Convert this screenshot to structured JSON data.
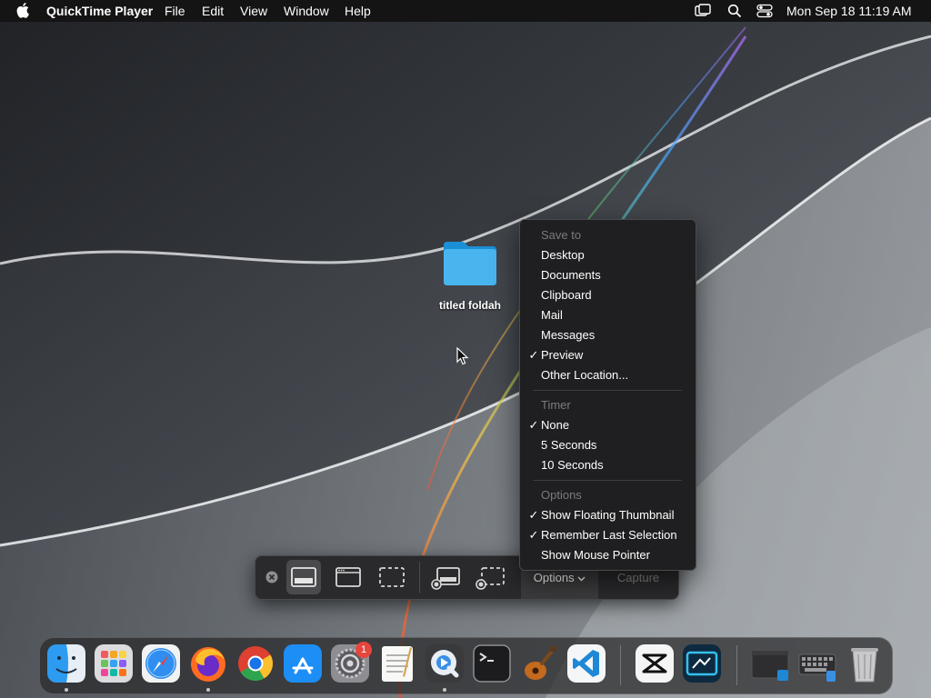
{
  "menubar": {
    "app_name": "QuickTime Player",
    "items": [
      "File",
      "Edit",
      "View",
      "Window",
      "Help"
    ],
    "clock": "Mon Sep 18  11:19 AM"
  },
  "desktop": {
    "folder_label": "titled foldah"
  },
  "toolbar": {
    "options_label": "Options",
    "capture_label": "Capture"
  },
  "options_menu": {
    "save_to_header": "Save to",
    "save_to": [
      {
        "label": "Desktop",
        "checked": false
      },
      {
        "label": "Documents",
        "checked": false
      },
      {
        "label": "Clipboard",
        "checked": false
      },
      {
        "label": "Mail",
        "checked": false
      },
      {
        "label": "Messages",
        "checked": false
      },
      {
        "label": "Preview",
        "checked": true
      },
      {
        "label": "Other Location...",
        "checked": false
      }
    ],
    "timer_header": "Timer",
    "timer": [
      {
        "label": "None",
        "checked": true
      },
      {
        "label": "5 Seconds",
        "checked": false
      },
      {
        "label": "10 Seconds",
        "checked": false
      }
    ],
    "options_header": "Options",
    "options": [
      {
        "label": "Show Floating Thumbnail",
        "checked": true
      },
      {
        "label": "Remember Last Selection",
        "checked": true
      },
      {
        "label": "Show Mouse Pointer",
        "checked": false
      }
    ],
    "check_glyph": "✓"
  },
  "dock": {
    "apps": [
      "finder-icon",
      "launchpad-icon",
      "safari-icon",
      "firefox-icon",
      "chrome-icon",
      "app-store-icon",
      "system-settings-icon",
      "textedit-icon",
      "quicktime-icon",
      "terminal-icon",
      "garageband-icon",
      "vscode-icon",
      "capcut-icon",
      "screen-recorder-icon",
      "window-thumbnail-icon",
      "keyboard-viewer-icon",
      "trash-icon"
    ],
    "settings_badge": "1"
  }
}
